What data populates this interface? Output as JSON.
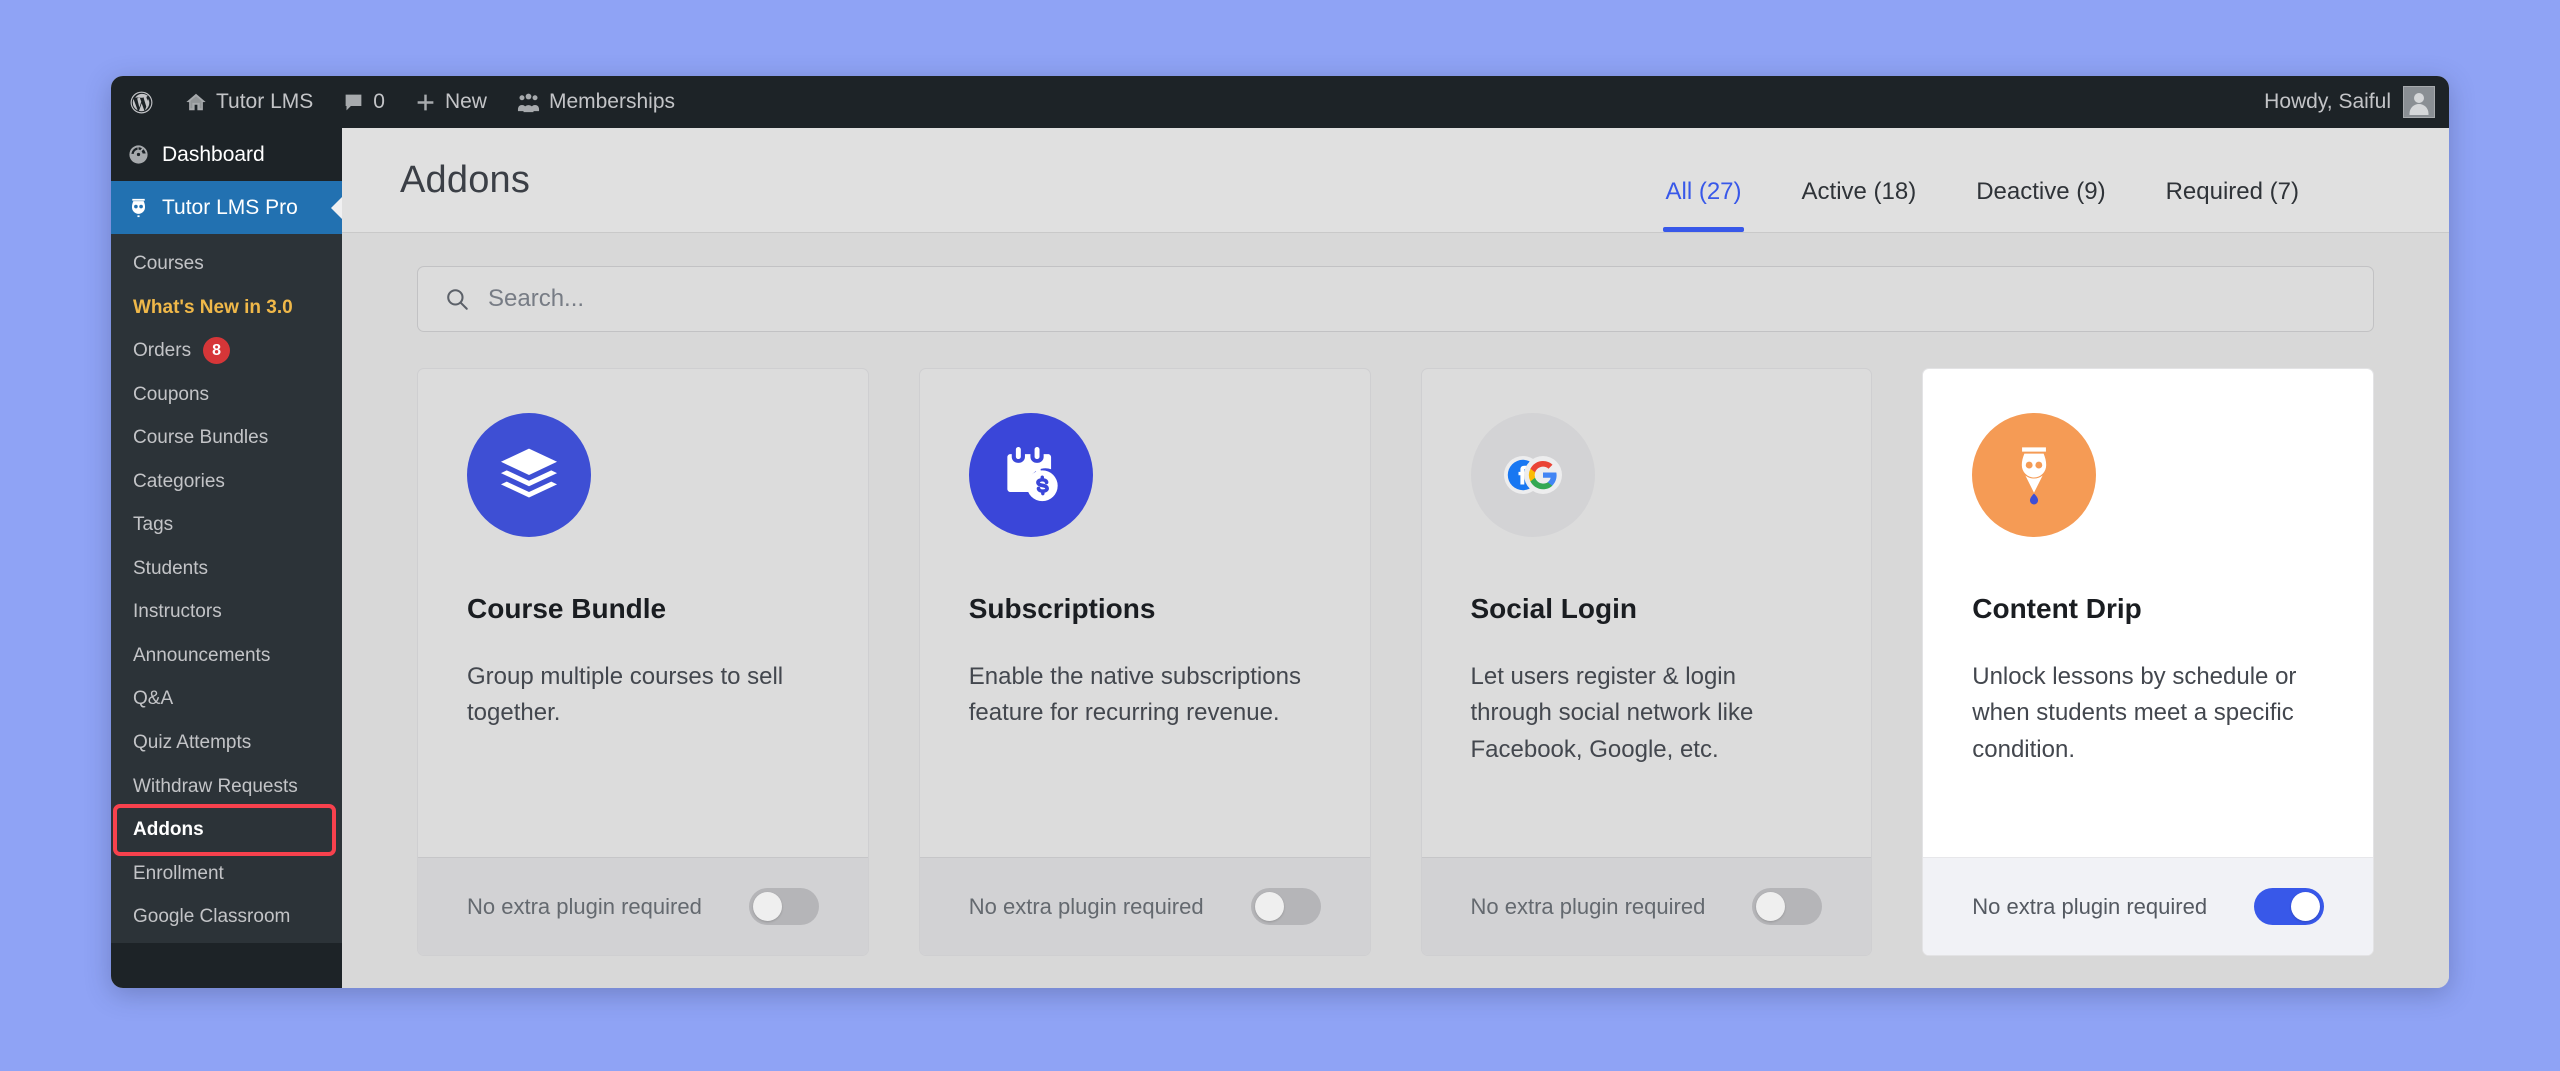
{
  "admin_bar": {
    "wp_logo_icon": "wordpress-icon",
    "items": [
      {
        "icon": "home-icon",
        "label": "Tutor LMS"
      },
      {
        "icon": "comment-icon",
        "label": "0"
      },
      {
        "icon": "plus-icon",
        "label": "New"
      },
      {
        "icon": "users-icon",
        "label": "Memberships"
      }
    ],
    "howdy": "Howdy, Saiful",
    "avatar_icon": "avatar-icon"
  },
  "sidebar": {
    "dashboard": {
      "label": "Dashboard",
      "icon": "dashboard-gauge-icon"
    },
    "tutor_pro": {
      "label": "Tutor LMS Pro",
      "icon": "tutor-owl-icon"
    },
    "submenu": [
      {
        "label": "Courses",
        "state": "normal"
      },
      {
        "label": "What's New in 3.0",
        "state": "promo"
      },
      {
        "label": "Orders",
        "state": "normal",
        "badge": "8"
      },
      {
        "label": "Coupons",
        "state": "normal"
      },
      {
        "label": "Course Bundles",
        "state": "normal"
      },
      {
        "label": "Categories",
        "state": "normal"
      },
      {
        "label": "Tags",
        "state": "normal"
      },
      {
        "label": "Students",
        "state": "normal"
      },
      {
        "label": "Instructors",
        "state": "normal"
      },
      {
        "label": "Announcements",
        "state": "normal"
      },
      {
        "label": "Q&A",
        "state": "normal"
      },
      {
        "label": "Quiz Attempts",
        "state": "normal"
      },
      {
        "label": "Withdraw Requests",
        "state": "normal"
      },
      {
        "label": "Addons",
        "state": "current",
        "annotated": true
      },
      {
        "label": "Enrollment",
        "state": "normal"
      },
      {
        "label": "Google Classroom",
        "state": "normal"
      }
    ]
  },
  "page": {
    "title": "Addons",
    "tabs": [
      {
        "label": "All (27)",
        "active": true
      },
      {
        "label": "Active (18)",
        "active": false
      },
      {
        "label": "Deactive (9)",
        "active": false
      },
      {
        "label": "Required (7)",
        "active": false
      }
    ]
  },
  "search": {
    "placeholder": "Search...",
    "value": "",
    "icon": "search-icon"
  },
  "addons": [
    {
      "title": "Course Bundle",
      "description": "Group multiple courses to sell together.",
      "footer_label": "No extra plugin required",
      "icon": "layers-icon",
      "icon_bg": "#3e4fd4",
      "enabled": false
    },
    {
      "title": "Subscriptions",
      "description": "Enable the native subscriptions feature for recurring revenue.",
      "footer_label": "No extra plugin required",
      "icon": "calendar-dollar-icon",
      "icon_bg": "#3a46d9",
      "enabled": false
    },
    {
      "title": "Social Login",
      "description": "Let users register & login through social network like Facebook, Google, etc.",
      "footer_label": "No extra plugin required",
      "icon": "facebook-google-icon",
      "icon_bg": "#d3d3d5",
      "enabled": false
    },
    {
      "title": "Content Drip",
      "description": "Unlock lessons by schedule or when students meet a specific condition.",
      "footer_label": "No extra plugin required",
      "icon": "content-drip-icon",
      "icon_bg": "#f59b55",
      "enabled": true
    }
  ],
  "colors": {
    "page_background": "#8fa3f5",
    "admin_bar": "#1d2327",
    "sidebar": "#2c3338",
    "accent_blue": "#3858e9",
    "active_menu": "#2271b1",
    "promo_yellow": "#f0b849",
    "badge_red": "#d63638",
    "annotation_red": "#f8414d"
  }
}
